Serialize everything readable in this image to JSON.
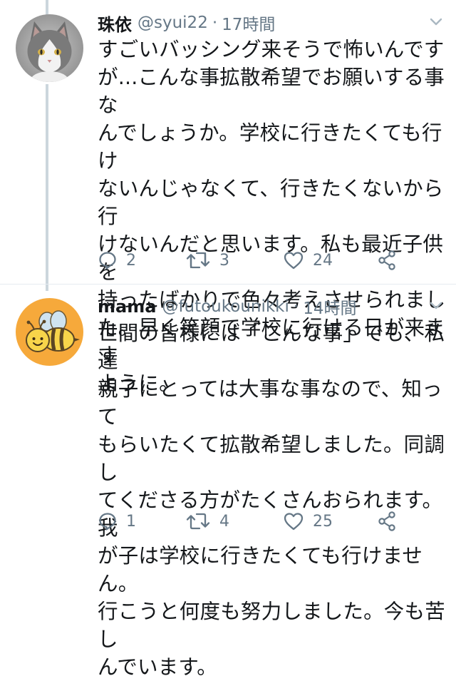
{
  "tweets": [
    {
      "display_name": "珠依",
      "handle": "@syui22",
      "separator": "·",
      "time": "17時間",
      "text": "すごいバッシング来そうで怖いんです\nが...こんな事拡散希望でお願いする事な\nんでしょうか。学校に行きたくても行け\nないんじゃなくて、行きたくないから行\nけないんだと思います。私も最近子供を\n持ったばかりで色々考えさせられまし\nた。早く笑顔で学校に行ける日が来ます\nように。",
      "reply_count": "2",
      "retweet_count": "3",
      "like_count": "24"
    },
    {
      "display_name": "mama",
      "handle": "@futoukounikki",
      "separator": "·",
      "time": "14時間",
      "text": "世間の皆様には「こんな事」でも、私達\n親子にとっては大事な事なので、知って\nもらいたくて拡散希望しました。同調し\nてくださる方がたくさんおられます。我\nが子は学校に行きたくても行けません。\n行こうと何度も努力しました。今も苦し\nんでいます。",
      "reply_count": "1",
      "retweet_count": "4",
      "like_count": "25"
    }
  ],
  "colors": {
    "text": "#14171a",
    "secondary": "#657786",
    "divider": "#e6ecf0",
    "thread_line": "#ccd6dd"
  },
  "icons": {
    "reply": "reply-icon",
    "retweet": "retweet-icon",
    "like": "heart-icon",
    "share": "share-icon",
    "menu": "chevron-down-icon"
  }
}
